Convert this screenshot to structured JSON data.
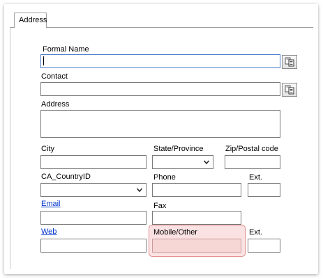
{
  "tab": {
    "label": "Address"
  },
  "labels": {
    "formal_name": "Formal Name",
    "contact": "Contact",
    "address": "Address",
    "city": "City",
    "state": "State/Province",
    "zip": "Zip/Postal code",
    "country": "CA_CountryID",
    "phone": "Phone",
    "ext1": "Ext.",
    "email": "Email",
    "fax": "Fax",
    "web": "Web",
    "mobile": "Mobile/Other",
    "ext2": "Ext."
  },
  "values": {
    "formal_name": "",
    "contact": "",
    "address": "",
    "city": "",
    "state": "",
    "zip": "",
    "country": "",
    "phone": "",
    "ext1": "",
    "email": "",
    "fax": "",
    "web": "",
    "mobile": "",
    "ext2": ""
  },
  "icons": {
    "copy_button": "copy-icon",
    "dropdown": "chevron-down-icon"
  },
  "colors": {
    "link": "#0033cc",
    "highlight_border": "#e08282",
    "highlight_fill": "#f5d2d2"
  }
}
